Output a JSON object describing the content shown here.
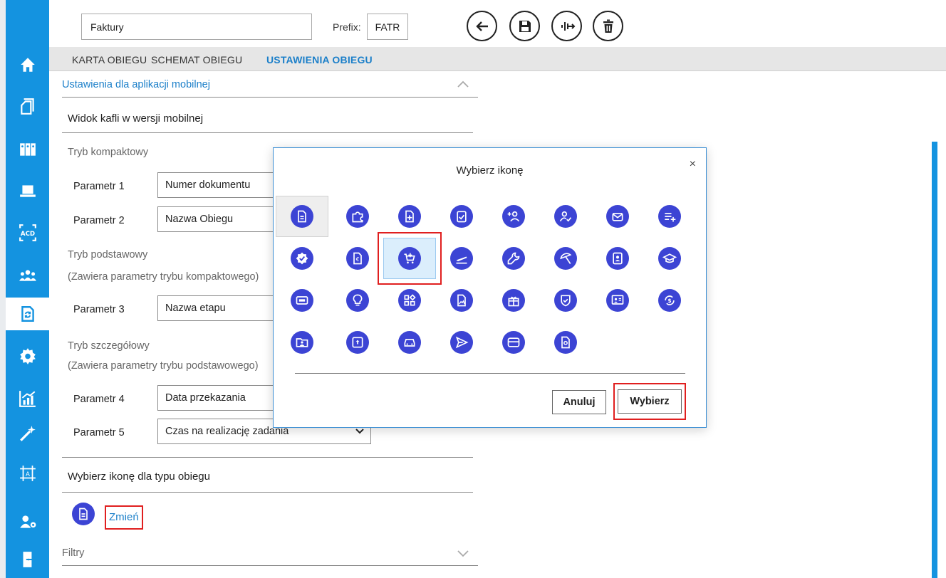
{
  "topbar": {
    "name_value": "Faktury",
    "prefix_label": "Prefix:",
    "prefix_value": "FATR",
    "buttons": [
      "back-icon",
      "save-icon",
      "export-icon",
      "delete-icon"
    ]
  },
  "tabs": [
    {
      "label": "KARTA OBIEGU",
      "active": false
    },
    {
      "label": "SCHEMAT OBIEGU",
      "active": false
    },
    {
      "label": "USTAWIENIA OBIEGU",
      "active": true
    }
  ],
  "sidebar": {
    "items": [
      "home-icon",
      "documents-icon",
      "binders-icon",
      "laptop-icon",
      "acd-icon",
      "team-icon",
      "workflow-icon",
      "settings-icon",
      "chart-icon",
      "magic-wand-icon",
      "text-frame-icon",
      "user-settings-icon",
      "exit-icon"
    ],
    "active_item": "workflow-icon"
  },
  "content": {
    "mobile_section_title": "Ustawienia dla aplikacji mobilnej",
    "tile_view_title": "Widok kafli w wersji mobilnej",
    "compact_mode": "Tryb kompaktowy",
    "basic_mode": "Tryb podstawowy",
    "basic_mode_note": "(Zawiera parametry trybu kompaktowego)",
    "detailed_mode": "Tryb szczegółowy",
    "detailed_mode_note": "(Zawiera parametry trybu podstawowego)",
    "params": [
      {
        "label": "Parametr 1",
        "value": "Numer dokumentu"
      },
      {
        "label": "Parametr 2",
        "value": "Nazwa Obiegu"
      },
      {
        "label": "Parametr 3",
        "value": "Nazwa etapu"
      },
      {
        "label": "Parametr 4",
        "value": "Data przekazania"
      },
      {
        "label": "Parametr 5",
        "value": "Czas na realizację zadania"
      }
    ],
    "choose_icon_title": "Wybierz ikonę dla typu obiegu",
    "change_link": "Zmień",
    "filters_title": "Filtry"
  },
  "dialog": {
    "title": "Wybierz ikonę",
    "close": "×",
    "cancel_label": "Anuluj",
    "choose_label": "Wybierz",
    "icons": [
      [
        "document-icon",
        "puzzle-icon",
        "document-plus-icon",
        "clipboard-check-icon",
        "add-user-icon",
        "user-check-icon",
        "mail-icon",
        "list-add-icon"
      ],
      [
        "badge-check-icon",
        "euro-document-icon",
        "shopping-cart-icon",
        "plane-icon",
        "wrench-icon",
        "beach-umbrella-icon",
        "id-card-icon",
        "graduation-cap-icon"
      ],
      [
        "ticket-icon",
        "lightbulb-icon",
        "widgets-icon",
        "image-document-icon",
        "gift-icon",
        "shield-check-icon",
        "presentation-icon",
        "money-refresh-icon"
      ],
      [
        "folder-user-icon",
        "inbox-icon",
        "car-icon",
        "send-icon",
        "card-icon",
        "document-search-icon"
      ]
    ]
  },
  "colors": {
    "sidebar": "#1493e0",
    "icon_circle": "#3c44d4",
    "highlight": "#e01f1f",
    "link": "#1b7fc9"
  }
}
